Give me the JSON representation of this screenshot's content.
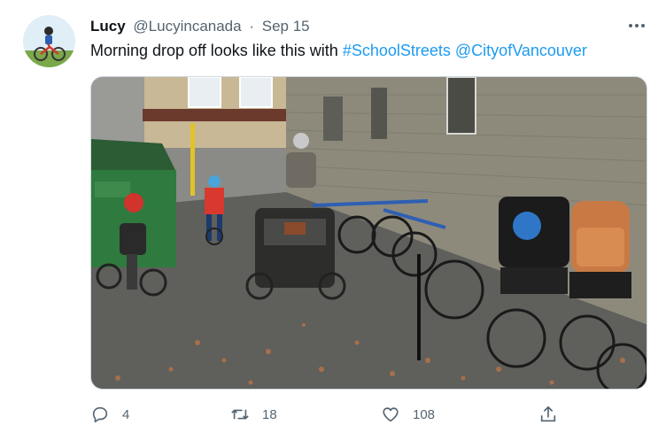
{
  "tweet": {
    "author_name": "Lucy",
    "handle": "@Lucyincanada",
    "separator": "·",
    "date": "Sep 15",
    "text_prefix": "Morning drop off looks like this with ",
    "hashtag": "#SchoolStreets",
    "space": " ",
    "mention": "@CityofVancouver",
    "more_icon": "more-icon"
  },
  "actions": {
    "reply_count": "4",
    "retweet_count": "18",
    "like_count": "108",
    "reply_icon": "reply-icon",
    "retweet_icon": "retweet-icon",
    "like_icon": "heart-icon",
    "share_icon": "share-icon"
  },
  "colors": {
    "link": "#1d9bf0",
    "secondary_text": "#536471",
    "primary_text": "#0f1419"
  }
}
